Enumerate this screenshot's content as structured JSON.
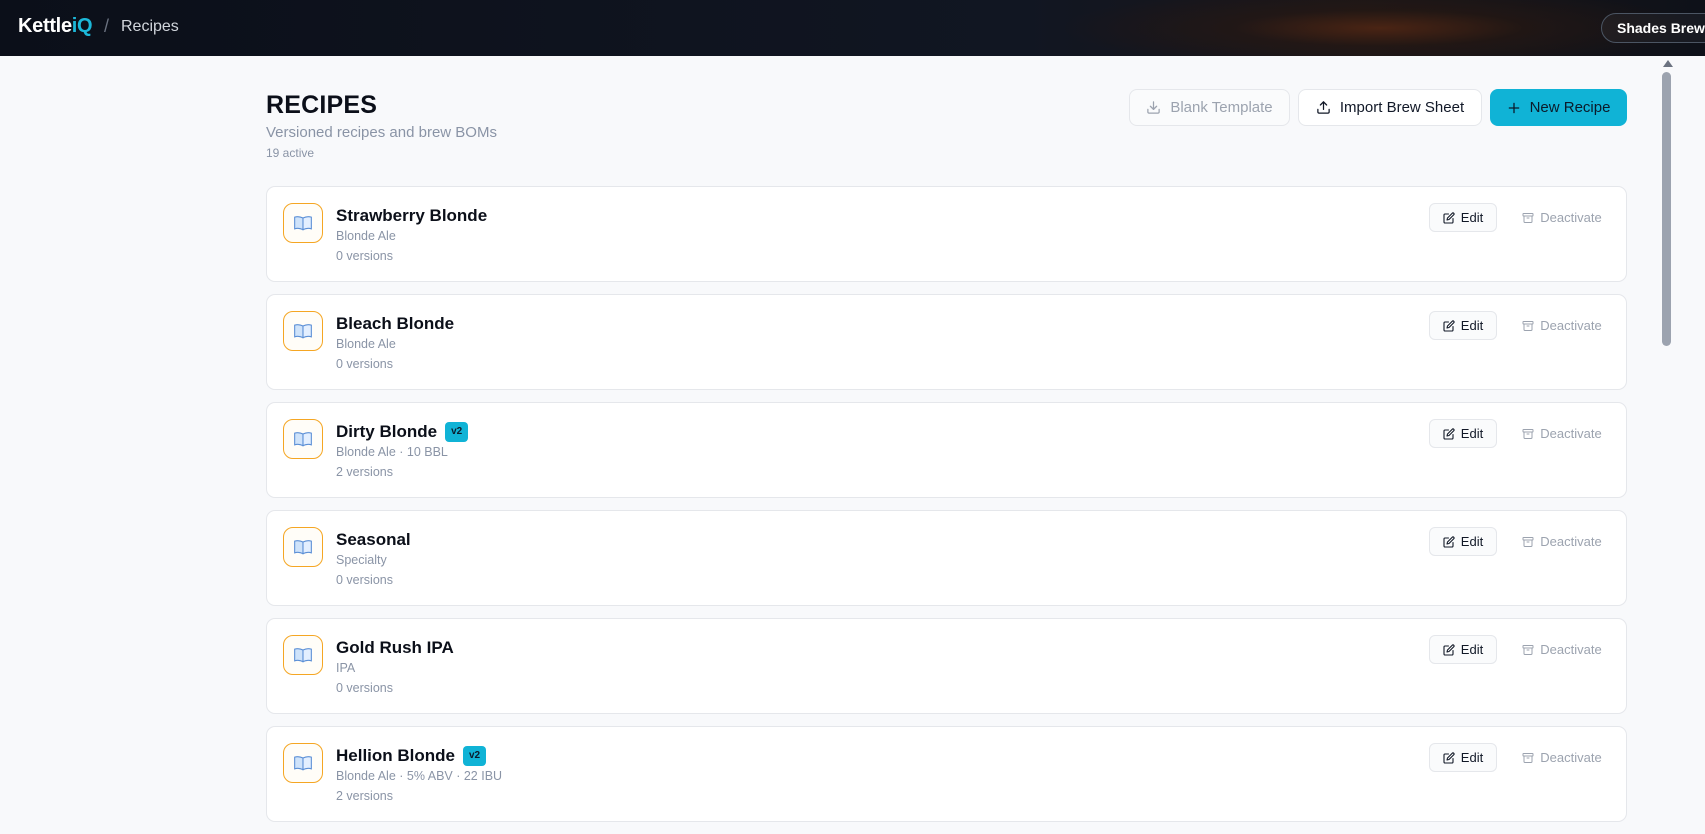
{
  "app": {
    "logo_main": "Kettle",
    "logo_accent": "iQ",
    "breadcrumb_sep": "/",
    "breadcrumb_current": "Recipes",
    "org_name": "Shades Brewing"
  },
  "header": {
    "title": "RECIPES",
    "subtitle": "Versioned recipes and brew BOMs",
    "count": "19 active"
  },
  "actions": {
    "blank_template": "Blank Template",
    "import_brew_sheet": "Import Brew Sheet",
    "new_recipe": "New Recipe"
  },
  "recipes": [
    {
      "name": "Strawberry Blonde",
      "badge": "",
      "meta": "Blonde Ale",
      "versions": "0 versions",
      "edit": "Edit",
      "deactivate": "Deactivate"
    },
    {
      "name": "Bleach Blonde",
      "badge": "",
      "meta": "Blonde Ale",
      "versions": "0 versions",
      "edit": "Edit",
      "deactivate": "Deactivate"
    },
    {
      "name": "Dirty Blonde",
      "badge": "v2",
      "meta": "Blonde Ale · 10 BBL",
      "versions": "2 versions",
      "edit": "Edit",
      "deactivate": "Deactivate"
    },
    {
      "name": "Seasonal",
      "badge": "",
      "meta": "Specialty",
      "versions": "0 versions",
      "edit": "Edit",
      "deactivate": "Deactivate"
    },
    {
      "name": "Gold Rush IPA",
      "badge": "",
      "meta": "IPA",
      "versions": "0 versions",
      "edit": "Edit",
      "deactivate": "Deactivate"
    },
    {
      "name": "Hellion Blonde",
      "badge": "v2",
      "meta": "Blonde Ale · 5% ABV · 22 IBU",
      "versions": "2 versions",
      "edit": "Edit",
      "deactivate": "Deactivate"
    }
  ],
  "icons": {
    "recipe": "book-icon",
    "blank": "download-icon",
    "import": "upload-icon",
    "new": "plus-icon",
    "edit": "edit-icon",
    "deactivate": "archive-icon"
  },
  "colors": {
    "accent": "#10b3d6",
    "icon_border": "#f5a623",
    "topbar": "#0b0f19"
  }
}
